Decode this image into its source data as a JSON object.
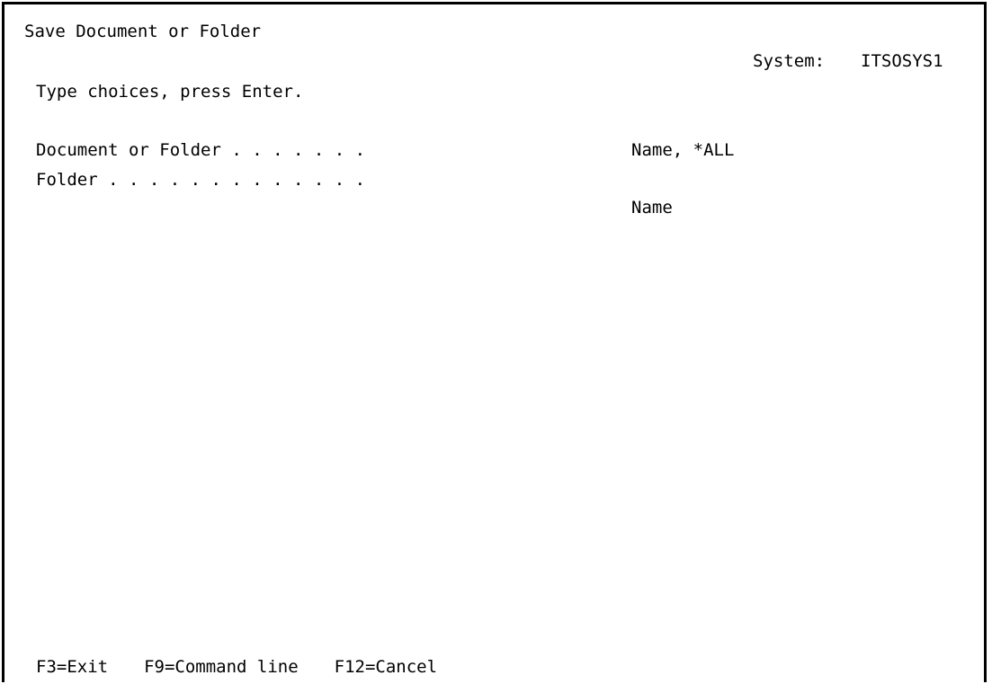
{
  "screen": {
    "title": "Save Document or Folder",
    "system_label": "System:",
    "system_value": "ITSOSYS1",
    "instructions": "Type choices, press Enter."
  },
  "fields": {
    "document_or_folder": {
      "label": "Document or Folder . . . . . . .",
      "help": "Name, *ALL",
      "value": ""
    },
    "folder": {
      "label": "Folder . . . . . . . . . . . . .",
      "help": "Name",
      "value": ""
    }
  },
  "function_keys": [
    {
      "label": "F3=Exit"
    },
    {
      "label": "F9=Command line"
    },
    {
      "label": "F12=Cancel"
    }
  ]
}
